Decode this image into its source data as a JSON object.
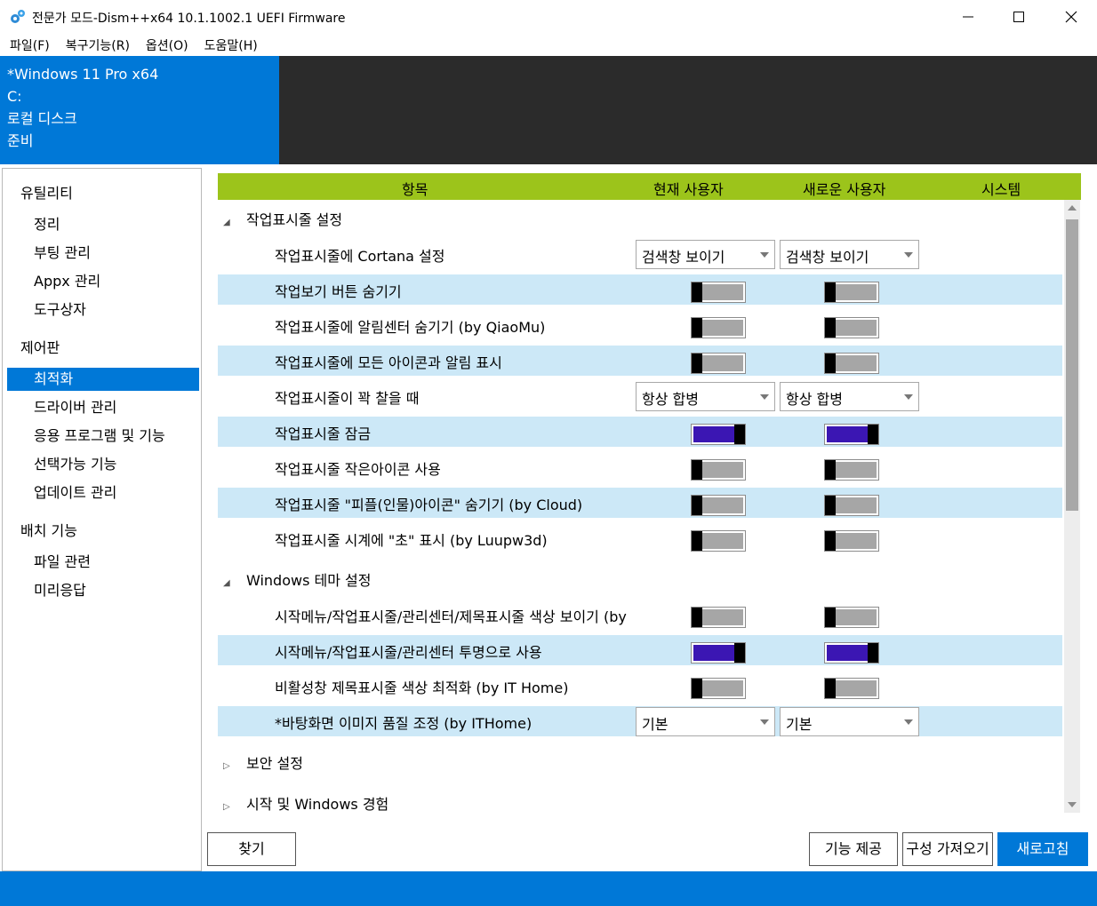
{
  "window": {
    "title": "전문가 모드-Dism++x64 10.1.1002.1 UEFI Firmware",
    "icons": {
      "app": "gears-icon",
      "minimize": "minimize-icon",
      "maximize": "maximize-icon",
      "close": "close-icon"
    }
  },
  "menu": [
    "파일(F)",
    "복구기능(R)",
    "옵션(O)",
    "도움말(H)"
  ],
  "image_info": {
    "name": "*Windows 11 Pro x64",
    "drive": "C:",
    "disk": "로컬 디스크",
    "status": "준비"
  },
  "sidebar": {
    "categories": [
      {
        "label": "유틸리티",
        "items": [
          "정리",
          "부팅 관리",
          "Appx 관리",
          "도구상자"
        ]
      },
      {
        "label": "제어판",
        "items": [
          "최적화",
          "드라이버 관리",
          "응용 프로그램 및 기능",
          "선택가능 기능",
          "업데이트 관리"
        ]
      },
      {
        "label": "배치 기능",
        "items": [
          "파일 관련",
          "미리응답"
        ]
      }
    ],
    "active_item": "최적화"
  },
  "table": {
    "columns": [
      "항목",
      "현재 사용자",
      "새로운 사용자",
      "시스템"
    ],
    "groups": [
      {
        "label": "작업표시줄 설정",
        "expanded": true,
        "rows": [
          {
            "label": "작업표시줄에 Cortana 설정",
            "type": "dropdown",
            "current": "검색창 보이기",
            "new": "검색창 보이기"
          },
          {
            "label": "작업보기 버튼 숨기기",
            "type": "toggle",
            "current": false,
            "new": false
          },
          {
            "label": "작업표시줄에 알림센터 숨기기 (by QiaoMu)",
            "type": "toggle",
            "current": false,
            "new": false
          },
          {
            "label": "작업표시줄에 모든 아이콘과 알림 표시",
            "type": "toggle",
            "current": false,
            "new": false
          },
          {
            "label": "작업표시줄이 꽉 찰을 때",
            "type": "dropdown",
            "current": "항상 합병",
            "new": "항상 합병"
          },
          {
            "label": "작업표시줄 잠금",
            "type": "toggle",
            "current": true,
            "new": true
          },
          {
            "label": "작업표시줄 작은아이콘 사용",
            "type": "toggle",
            "current": false,
            "new": false
          },
          {
            "label": "작업표시줄 \"피플(인물)아이콘\" 숨기기 (by Cloud)",
            "type": "toggle",
            "current": false,
            "new": false
          },
          {
            "label": "작업표시줄 시계에 \"초\" 표시 (by Luupw3d)",
            "type": "toggle",
            "current": false,
            "new": false
          }
        ]
      },
      {
        "label": "Windows 테마 설정",
        "expanded": true,
        "rows": [
          {
            "label": "시작메뉴/작업표시줄/관리센터/제목표시줄 색상 보이기 (by",
            "type": "toggle",
            "current": false,
            "new": false
          },
          {
            "label": "시작메뉴/작업표시줄/관리센터 투명으로 사용",
            "type": "toggle",
            "current": true,
            "new": true
          },
          {
            "label": "비활성창 제목표시줄 색상 최적화 (by IT Home)",
            "type": "toggle",
            "current": false,
            "new": false
          },
          {
            "label": "*바탕화면 이미지 품질 조정 (by ITHome)",
            "type": "dropdown",
            "current": "기본",
            "new": "기본"
          }
        ]
      },
      {
        "label": "보안 설정",
        "expanded": false,
        "rows": []
      },
      {
        "label": "시작 및 Windows 경험",
        "expanded": false,
        "rows": []
      }
    ]
  },
  "buttons": {
    "find": "찾기",
    "provide": "기능 제공",
    "import": "구성 가져오기",
    "refresh": "새로고침"
  },
  "colors": {
    "accent": "#0078d7",
    "header_bar": "#9cc41b",
    "row_alt": "#cce8f7",
    "toggle_on": "#3b16b3",
    "toggle_off": "#a6a6a6"
  }
}
